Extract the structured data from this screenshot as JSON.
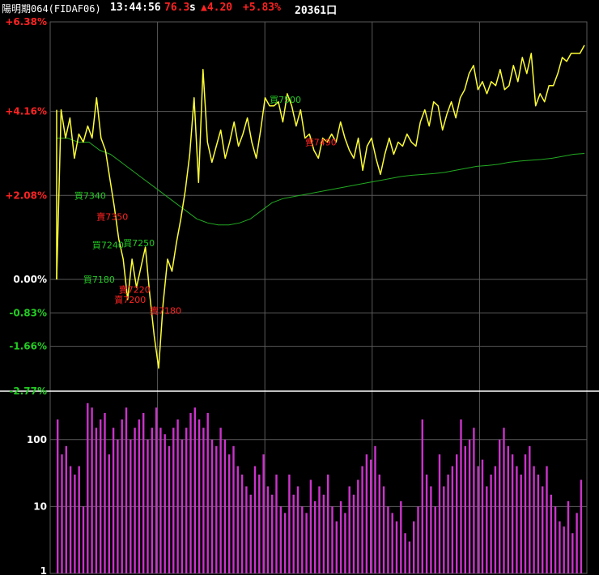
{
  "header": {
    "symbol": "陽明期064(FIDAF06)",
    "time": "13:44:56",
    "price": "76.3",
    "unit": "s",
    "change": "▲4.20",
    "change_pct": "+5.83%",
    "volume": "20361口"
  },
  "colors": {
    "background": "#000000",
    "grid": "#5a5a5a",
    "price_line": "#ffff33",
    "avg_line": "#22aa22",
    "volume_bars": "#cc33cc",
    "up": "#ff2222",
    "down": "#22cc22",
    "neutral": "#ffffff"
  },
  "chart_data": [
    {
      "type": "line",
      "y_unit": "percent change",
      "yticks": [
        {
          "value": 6.38,
          "label": "+6.38%",
          "tone": "up"
        },
        {
          "value": 4.16,
          "label": "+4.16%",
          "tone": "up"
        },
        {
          "value": 2.08,
          "label": "+2.08%",
          "tone": "up"
        },
        {
          "value": 0.0,
          "label": "0.00%",
          "tone": "neutral"
        },
        {
          "value": -0.83,
          "label": "-0.83%",
          "tone": "down"
        },
        {
          "value": -1.66,
          "label": "-1.66%",
          "tone": "down"
        },
        {
          "value": -2.77,
          "label": "-2.77%",
          "tone": "down"
        }
      ],
      "ylim": [
        -2.77,
        6.38
      ],
      "x_count": 120,
      "series": [
        {
          "role": "price",
          "values": [
            0.0,
            4.2,
            3.5,
            4.0,
            3.0,
            3.6,
            3.4,
            3.8,
            3.5,
            4.5,
            3.5,
            3.2,
            2.5,
            1.8,
            1.0,
            0.5,
            -0.5,
            0.5,
            -0.2,
            0.3,
            0.8,
            -0.4,
            -1.4,
            -2.2,
            -0.6,
            0.5,
            0.2,
            0.9,
            1.5,
            2.2,
            3.1,
            4.5,
            2.4,
            5.2,
            3.4,
            2.9,
            3.3,
            3.7,
            3.0,
            3.4,
            3.9,
            3.3,
            3.6,
            4.0,
            3.4,
            3.0,
            3.7,
            4.5,
            4.3,
            4.3,
            4.4,
            3.9,
            4.6,
            4.3,
            3.8,
            4.2,
            3.5,
            3.6,
            3.2,
            3.0,
            3.5,
            3.4,
            3.6,
            3.4,
            3.9,
            3.5,
            3.2,
            3.0,
            3.5,
            2.7,
            3.3,
            3.5,
            3.0,
            2.6,
            3.1,
            3.5,
            3.1,
            3.4,
            3.3,
            3.6,
            3.4,
            3.3,
            3.9,
            4.2,
            3.8,
            4.4,
            4.3,
            3.7,
            4.1,
            4.4,
            4.0,
            4.5,
            4.7,
            5.1,
            5.3,
            4.7,
            4.9,
            4.6,
            4.9,
            4.8,
            5.2,
            4.7,
            4.8,
            5.3,
            4.9,
            5.5,
            5.1,
            5.6,
            4.3,
            4.6,
            4.4,
            4.8,
            4.8,
            5.1,
            5.5,
            5.4,
            5.6,
            5.6,
            5.6,
            5.8
          ]
        },
        {
          "role": "average",
          "values": [
            3.5,
            3.5,
            3.4,
            3.4,
            3.2,
            3.1,
            2.9,
            2.7,
            2.5,
            2.3,
            2.1,
            1.9,
            1.7,
            1.5,
            1.4,
            1.35,
            1.35,
            1.4,
            1.5,
            1.7,
            1.9,
            2.0,
            2.05,
            2.1,
            2.15,
            2.2,
            2.25,
            2.3,
            2.35,
            2.4,
            2.45,
            2.5,
            2.55,
            2.58,
            2.6,
            2.62,
            2.65,
            2.7,
            2.75,
            2.8,
            2.82,
            2.85,
            2.9,
            2.93,
            2.95,
            2.97,
            3.0,
            3.05,
            3.1,
            3.12
          ]
        }
      ],
      "annotations": [
        {
          "label": "買7340",
          "tone": "down",
          "i": 4,
          "y": 2.08
        },
        {
          "label": "賣7350",
          "tone": "up",
          "i": 9,
          "y": 1.55
        },
        {
          "label": "買7240",
          "tone": "down",
          "i": 8,
          "y": 0.85
        },
        {
          "label": "買7250",
          "tone": "down",
          "i": 15,
          "y": 0.9
        },
        {
          "label": "買7180",
          "tone": "down",
          "i": 6,
          "y": 0.0
        },
        {
          "label": "賣7220",
          "tone": "up",
          "i": 14,
          "y": -0.25
        },
        {
          "label": "賣7200",
          "tone": "up",
          "i": 13,
          "y": -0.5
        },
        {
          "label": "賣7180",
          "tone": "up",
          "i": 21,
          "y": -0.77
        },
        {
          "label": "買7500",
          "tone": "down",
          "i": 48,
          "y": 4.45
        },
        {
          "label": "賣7490",
          "tone": "up",
          "i": 56,
          "y": 3.4
        }
      ]
    },
    {
      "type": "bar",
      "scale": "log",
      "ylim": [
        1,
        500
      ],
      "yticks": [
        {
          "value": 100,
          "label": "100"
        },
        {
          "value": 10,
          "label": "10"
        },
        {
          "value": 1,
          "label": "1"
        }
      ],
      "values": [
        200,
        60,
        80,
        40,
        30,
        40,
        10,
        350,
        300,
        150,
        200,
        250,
        60,
        150,
        100,
        200,
        300,
        100,
        150,
        200,
        250,
        100,
        150,
        300,
        150,
        120,
        80,
        150,
        200,
        100,
        150,
        250,
        300,
        200,
        150,
        250,
        100,
        80,
        150,
        100,
        60,
        80,
        40,
        30,
        20,
        15,
        40,
        30,
        60,
        20,
        15,
        30,
        10,
        8,
        30,
        15,
        20,
        10,
        8,
        25,
        12,
        20,
        15,
        30,
        10,
        6,
        12,
        8,
        20,
        15,
        25,
        40,
        60,
        50,
        80,
        30,
        20,
        10,
        8,
        6,
        12,
        4,
        3,
        6,
        10,
        200,
        30,
        20,
        10,
        60,
        20,
        30,
        40,
        60,
        200,
        80,
        100,
        150,
        40,
        50,
        20,
        30,
        40,
        100,
        150,
        80,
        60,
        40,
        30,
        60,
        80,
        40,
        30,
        20,
        40,
        15,
        10,
        6,
        5,
        12,
        4,
        8,
        25
      ]
    }
  ]
}
